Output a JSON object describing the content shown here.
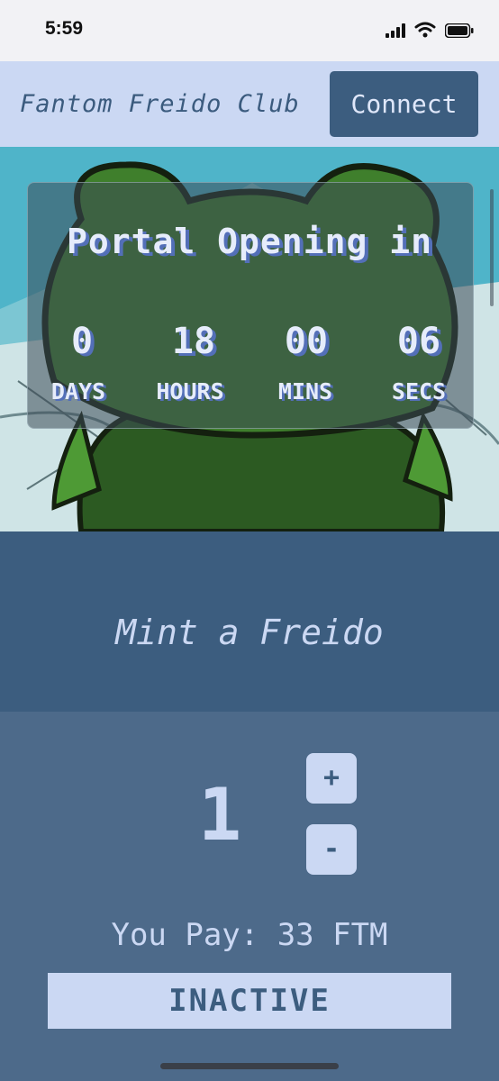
{
  "status_bar": {
    "time": "5:59"
  },
  "header": {
    "brand": "Fantom Freido Club",
    "connect_label": "Connect"
  },
  "countdown": {
    "title": "Portal Opening in",
    "units": [
      {
        "value": "0",
        "label": "DAYS"
      },
      {
        "value": "18",
        "label": "HOURS"
      },
      {
        "value": "00",
        "label": "MINS"
      },
      {
        "value": "06",
        "label": "SECS"
      }
    ]
  },
  "mint": {
    "title": "Mint a Freido",
    "quantity": "1",
    "plus_label": "+",
    "minus_label": "-",
    "pay_text": "You Pay: 33 FTM",
    "action_label": "INACTIVE"
  },
  "colors": {
    "nav_bg": "#cbd8f3",
    "accent": "#3c5d7f",
    "panel": "#4d6a8a"
  }
}
